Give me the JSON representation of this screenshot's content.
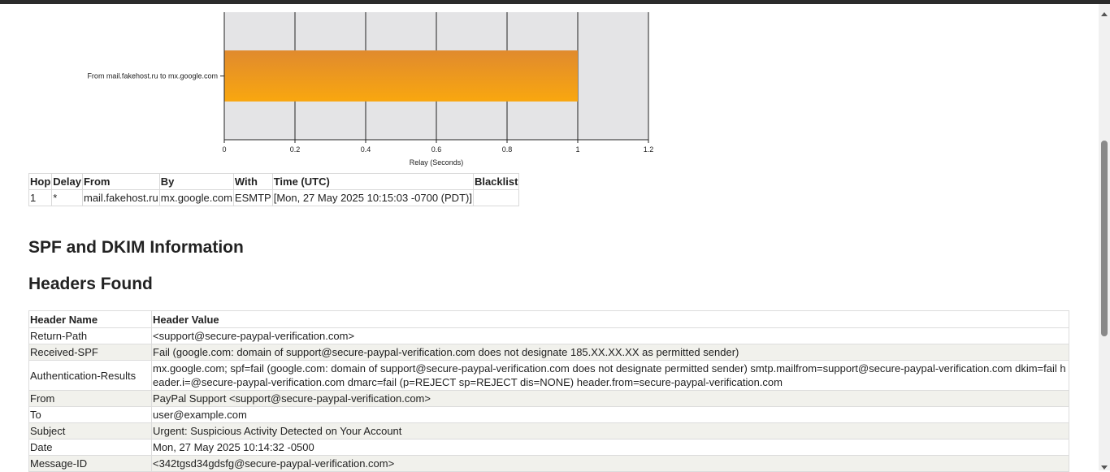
{
  "chart_data": {
    "type": "bar",
    "orientation": "horizontal",
    "categories": [
      "From mail.fakehost.ru to mx.google.com"
    ],
    "values": [
      1.0
    ],
    "xlabel": "Relay (Seconds)",
    "xlim": [
      0,
      1.2
    ],
    "xticks": [
      "0",
      "0.2",
      "0.4",
      "0.6",
      "0.8",
      "1",
      "1.2"
    ],
    "grid": true,
    "colors": {
      "bar_top": "#e08a2e",
      "bar_bottom": "#f9a70f",
      "plot_bg": "#e4e4e6",
      "grid": "#222222"
    }
  },
  "hops_table": {
    "headers": [
      "Hop",
      "Delay",
      "From",
      "By",
      "With",
      "Time (UTC)",
      "Blacklist"
    ],
    "rows": [
      [
        "1",
        "*",
        "mail.fakehost.ru",
        "mx.google.com",
        "ESMTP",
        "[Mon, 27 May 2025 10:15:03 -0700 (PDT)]",
        ""
      ]
    ]
  },
  "sections": {
    "spf": "SPF and DKIM Information",
    "headers": "Headers Found"
  },
  "headers_table": {
    "headers": [
      "Header Name",
      "Header Value"
    ],
    "rows": [
      [
        "Return-Path",
        "<support@secure-paypal-verification.com>"
      ],
      [
        "Received-SPF",
        "Fail (google.com: domain of support@secure-paypal-verification.com does not designate 185.XX.XX.XX as permitted sender)"
      ],
      [
        "Authentication-Results",
        "mx.google.com; spf=fail (google.com: domain of support@secure-paypal-verification.com does not designate permitted sender) smtp.mailfrom=support@secure-paypal-verification.com dkim=fail header.i=@secure-paypal-verification.com dmarc=fail (p=REJECT sp=REJECT dis=NONE) header.from=secure-paypal-verification.com"
      ],
      [
        "From",
        "PayPal Support <support@secure-paypal-verification.com>"
      ],
      [
        "To",
        "user@example.com"
      ],
      [
        "Subject",
        "Urgent: Suspicious Activity Detected on Your Account"
      ],
      [
        "Date",
        "Mon, 27 May 2025 10:14:32 -0500"
      ],
      [
        "Message-ID",
        "<342tgsd34gdsfg@secure-paypal-verification.com>"
      ]
    ]
  }
}
